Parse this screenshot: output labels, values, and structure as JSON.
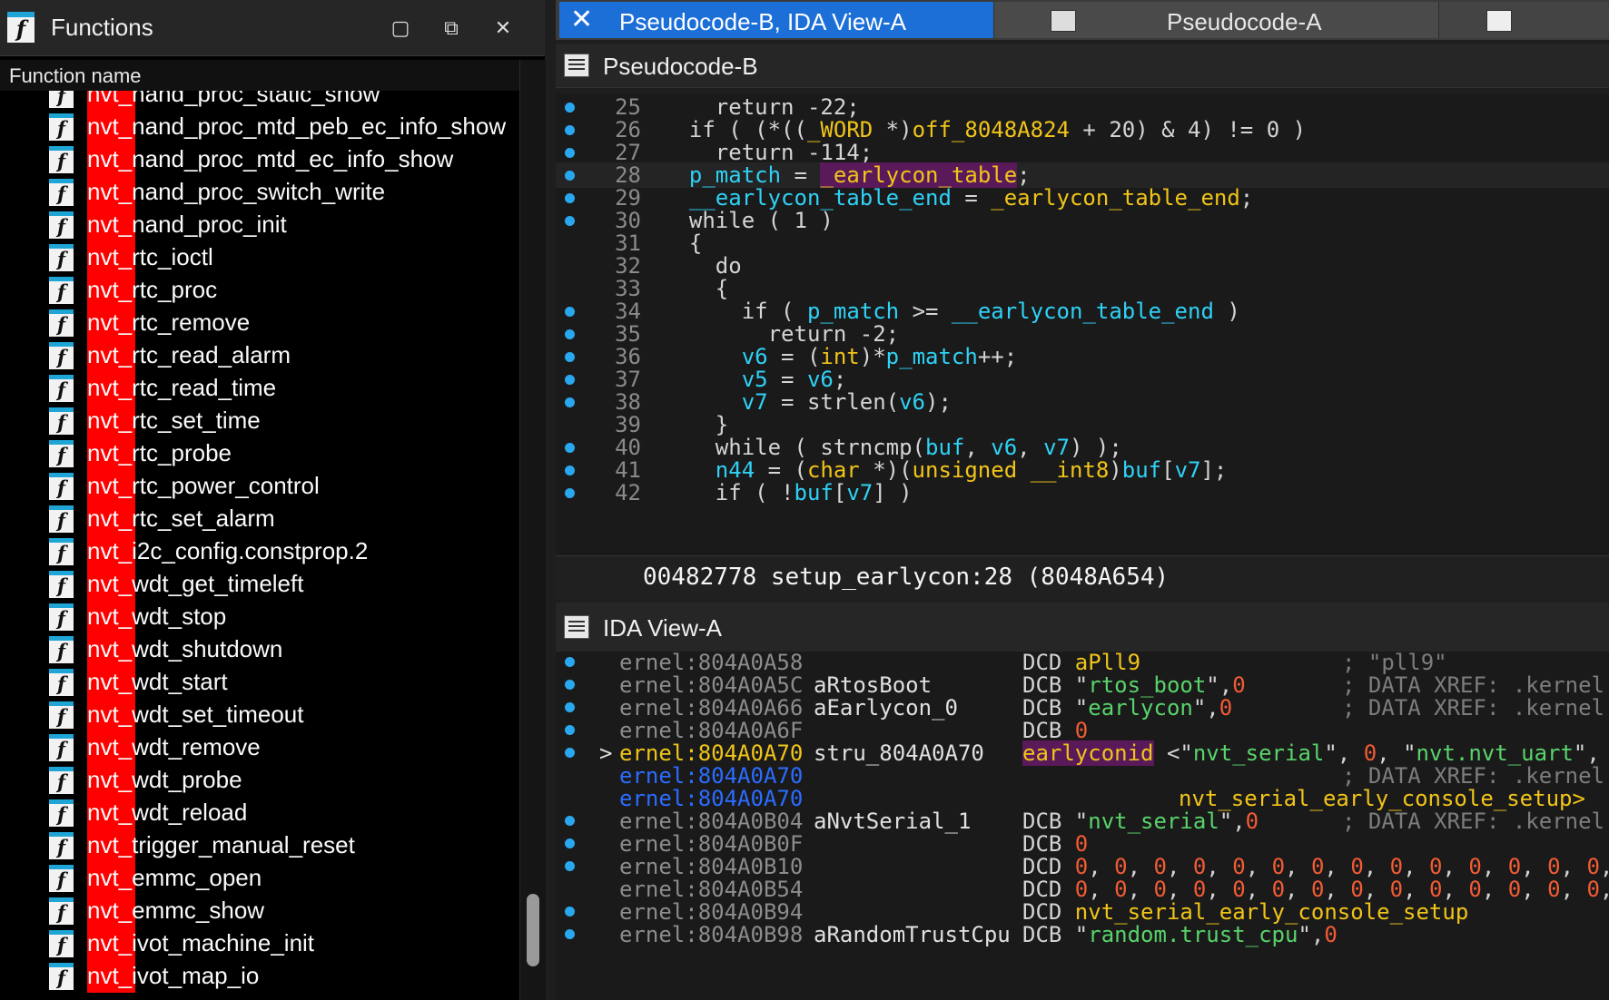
{
  "functions_pane": {
    "title": "Functions",
    "column_header": "Function name",
    "items": [
      "nvt_nand_proc_static_show",
      "nvt_nand_proc_mtd_peb_ec_info_show",
      "nvt_nand_proc_mtd_ec_info_show",
      "nvt_nand_proc_switch_write",
      "nvt_nand_proc_init",
      "nvt_rtc_ioctl",
      "nvt_rtc_proc",
      "nvt_rtc_remove",
      "nvt_rtc_read_alarm",
      "nvt_rtc_read_time",
      "nvt_rtc_set_time",
      "nvt_rtc_probe",
      "nvt_rtc_power_control",
      "nvt_rtc_set_alarm",
      "nvt_i2c_config.constprop.2",
      "nvt_wdt_get_timeleft",
      "nvt_wdt_stop",
      "nvt_wdt_shutdown",
      "nvt_wdt_start",
      "nvt_wdt_set_timeout",
      "nvt_wdt_remove",
      "nvt_wdt_probe",
      "nvt_wdt_reload",
      "nvt_trigger_manual_reset",
      "nvt_emmc_open",
      "nvt_emmc_show",
      "nvt_ivot_machine_init",
      "nvt_ivot_map_io"
    ]
  },
  "tabs": {
    "active": "Pseudocode-B, IDA View-A",
    "second": "Pseudocode-A"
  },
  "pseudocode": {
    "title": "Pseudocode-B",
    "status": "00482778 setup_earlycon:28 (8048A654)",
    "lines": [
      {
        "n": "25",
        "bp": true
      },
      {
        "n": "26",
        "bp": true
      },
      {
        "n": "27",
        "bp": true
      },
      {
        "n": "28",
        "bp": true
      },
      {
        "n": "29",
        "bp": true
      },
      {
        "n": "30",
        "bp": true
      },
      {
        "n": "31",
        "bp": false
      },
      {
        "n": "32",
        "bp": false
      },
      {
        "n": "33",
        "bp": false
      },
      {
        "n": "34",
        "bp": true
      },
      {
        "n": "35",
        "bp": true
      },
      {
        "n": "36",
        "bp": true
      },
      {
        "n": "37",
        "bp": true
      },
      {
        "n": "38",
        "bp": true
      },
      {
        "n": "39",
        "bp": false
      },
      {
        "n": "40",
        "bp": true
      },
      {
        "n": "41",
        "bp": true
      },
      {
        "n": "42",
        "bp": true
      }
    ]
  },
  "ida_view": {
    "title": "IDA View-A",
    "lines": [
      {
        "addr": "ernel:804A0A58",
        "label": "",
        "ins": "DCD aPll9",
        "cmt": "; \"pll9\""
      },
      {
        "addr": "ernel:804A0A5C",
        "label": "aRtosBoot",
        "ins": "DCB \"rtos_boot\",0",
        "cmt": "; DATA XREF: .kernel:"
      },
      {
        "addr": "ernel:804A0A66",
        "label": "aEarlycon_0",
        "ins": "DCB \"earlycon\",0",
        "cmt": "; DATA XREF: .kernel:"
      },
      {
        "addr": "ernel:804A0A6F",
        "label": "",
        "ins": "DCB 0",
        "cmt": ""
      },
      {
        "addr": "ernel:804A0A70",
        "label": "stru_804A0A70",
        "ins": "earlyconid <\"nvt_serial\", 0, \"nvt.nvt_uart\",",
        "cmt": ""
      },
      {
        "addr": "ernel:804A0A70",
        "label": "",
        "ins": "",
        "cmt": "; DATA XREF: .kernel:"
      },
      {
        "addr": "ernel:804A0A70",
        "label": "",
        "ins": "nvt_serial_early_console_setup>",
        "cmt": ""
      },
      {
        "addr": "ernel:804A0B04",
        "label": "aNvtSerial_1",
        "ins": "DCB \"nvt_serial\",0",
        "cmt": "; DATA XREF: .kernel:"
      },
      {
        "addr": "ernel:804A0B0F",
        "label": "",
        "ins": "DCB 0",
        "cmt": ""
      },
      {
        "addr": "ernel:804A0B10",
        "label": "",
        "ins": "DCD 0, 0, 0, 0, 0, 0, 0, 0, 0, 0, 0, 0, 0, 0, 0,",
        "cmt": ""
      },
      {
        "addr": "ernel:804A0B54",
        "label": "",
        "ins": "DCD 0, 0, 0, 0, 0, 0, 0, 0, 0, 0, 0, 0, 0, 0, 0,",
        "cmt": ""
      },
      {
        "addr": "ernel:804A0B94",
        "label": "",
        "ins": "DCD nvt_serial_early_console_setup",
        "cmt": ""
      },
      {
        "addr": "ernel:804A0B98",
        "label": "aRandomTrustCpu",
        "ins": "DCB \"random.trust_cpu\",0",
        "cmt": ""
      }
    ]
  },
  "colors": {
    "accent_tab": "#1d6fd8",
    "function_prefix_highlight": "#ff0000",
    "breakpoint_dot": "#29a8f0",
    "identifier": "#2fd1f5",
    "type_keyword": "#f0c419",
    "string_literal": "#59d36b"
  }
}
